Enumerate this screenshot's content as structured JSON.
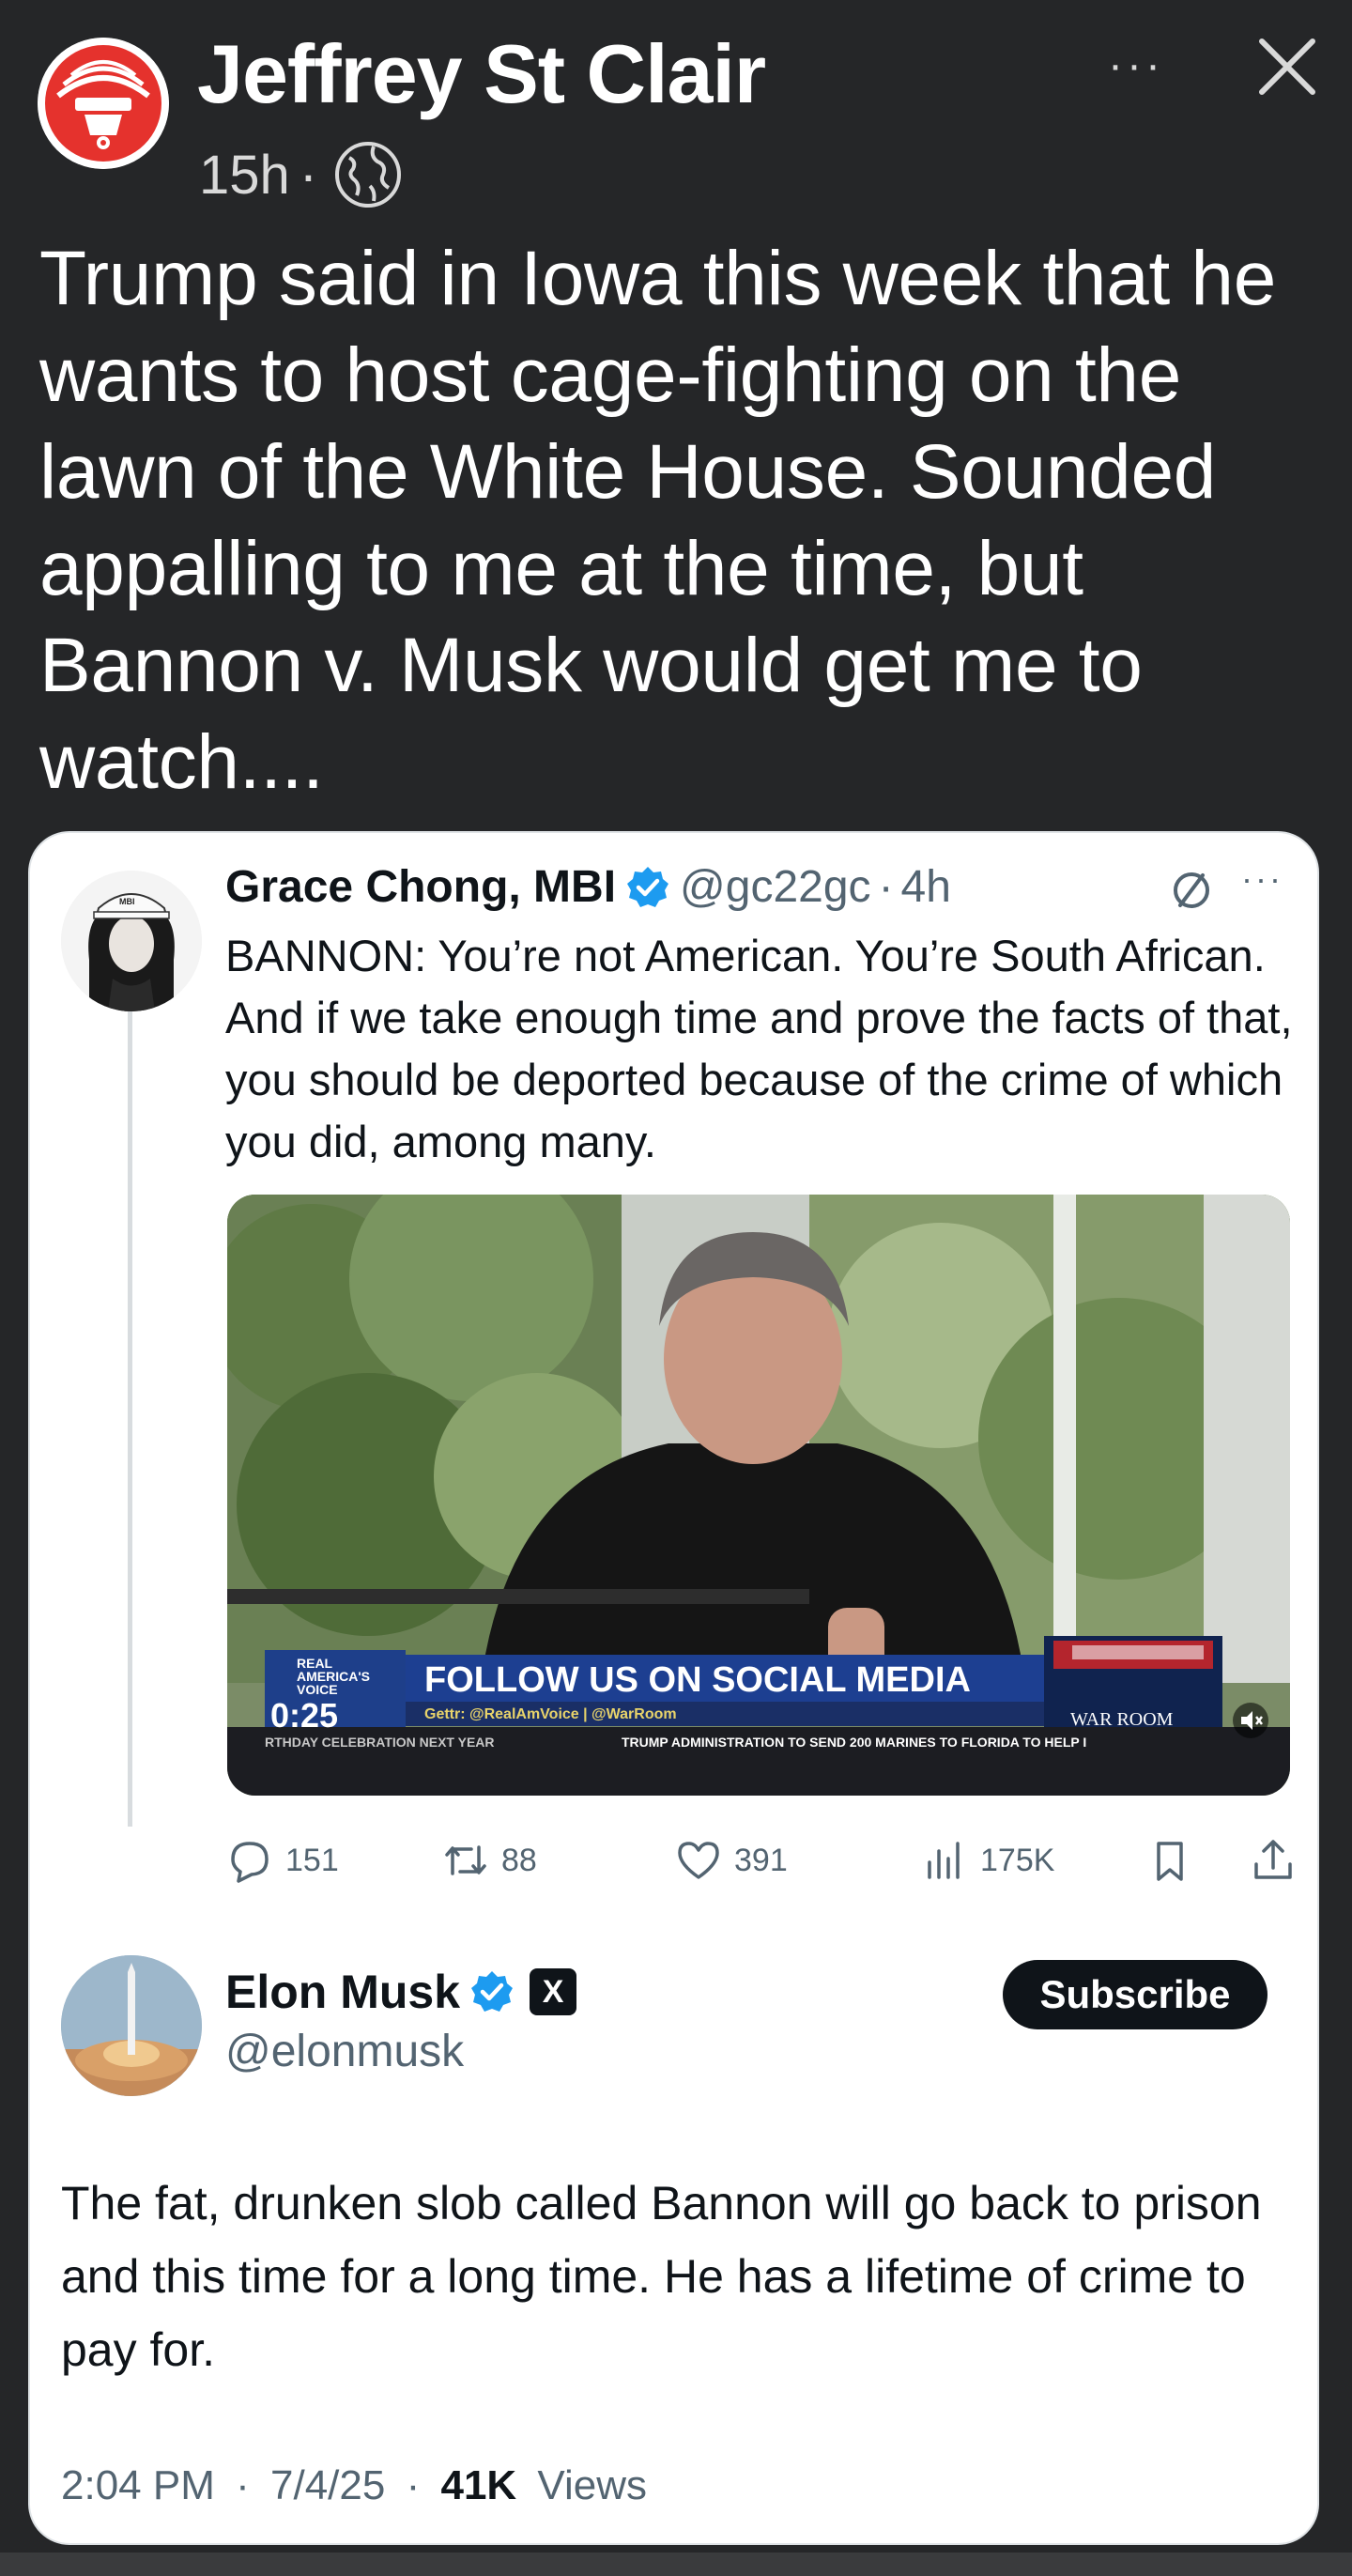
{
  "post": {
    "author": "Jeffrey St Clair",
    "time": "15h",
    "separator": "·",
    "more_label": "···",
    "text": "Trump said in Iowa this week that he wants to host cage-fighting on the lawn of the White House. Sounded appalling to me at the time, but Bannon v. Musk would get me to watch...."
  },
  "tweet1": {
    "name": "Grace Chong, MBI",
    "handle": "@gc22gc",
    "separator": "·",
    "time": "4h",
    "more_label": "···",
    "avatar_cap": "MBI",
    "text": "BANNON: You’re not American. You’re South African. And if we take enough time and prove the facts of that, you should be deported because of the crime of which you did, among many.",
    "video": {
      "banner": "FOLLOW US ON SOCIAL MEDIA",
      "social": "Gettr: @RealAmVoice | @WarRoom",
      "network": "REAL AMERICA'S VOICE",
      "duration": "0:25",
      "ticker_left": "RTHDAY CELEBRATION NEXT YEAR",
      "ticker_right": "TRUMP ADMINISTRATION TO SEND 200 MARINES TO FLORIDA TO HELP I",
      "logo": "WAR ROOM"
    },
    "actions": {
      "replies": "151",
      "reposts": "88",
      "likes": "391",
      "views": "175K"
    }
  },
  "tweet2": {
    "name": "Elon Musk",
    "handle": "@elonmusk",
    "x_badge": "X",
    "subscribe": "Subscribe",
    "text": "The fat, drunken slob called Bannon will go back to prison and this time for a long time. He has a lifetime of crime to pay for.",
    "time": "2:04 PM",
    "date": "7/4/25",
    "views_count": "41K",
    "views_label": "Views",
    "separator": "·"
  },
  "colors": {
    "header_bg": "#252628",
    "verified": "#1d9bf0",
    "avatar_red": "#e5322d",
    "text_dark": "#0f1419",
    "text_muted": "#536471"
  },
  "icons": [
    "globe-icon",
    "close-icon",
    "verified-icon",
    "no-sign-icon",
    "reply-icon",
    "repost-icon",
    "like-icon",
    "views-icon",
    "bookmark-icon",
    "share-icon",
    "x-logo-icon",
    "speaker-icon"
  ]
}
